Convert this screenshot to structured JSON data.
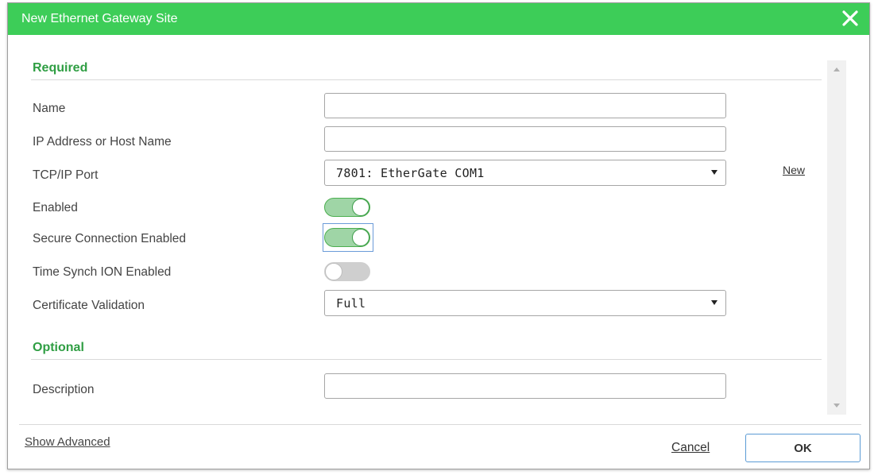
{
  "dialog": {
    "title": "New Ethernet Gateway Site",
    "close_icon": "close-icon"
  },
  "required": {
    "title": "Required",
    "name_label": "Name",
    "name_value": "",
    "ip_label": "IP Address or Host Name",
    "ip_value": "",
    "port_label": "TCP/IP Port",
    "port_value": "7801: EtherGate COM1",
    "new_link": "New",
    "enabled_label": "Enabled",
    "enabled_on": true,
    "secure_label": "Secure Connection Enabled",
    "secure_on": true,
    "timesynch_label": "Time Synch ION Enabled",
    "timesynch_on": false,
    "cert_label": "Certificate Validation",
    "cert_value": "Full"
  },
  "optional": {
    "title": "Optional",
    "description_label": "Description",
    "description_value": ""
  },
  "footer": {
    "show_advanced": "Show Advanced",
    "cancel": "Cancel",
    "ok": "OK"
  },
  "colors": {
    "titlebar": "#3dcd58",
    "section_title": "#2f9e43",
    "toggle_on": "#9fd5a6",
    "toggle_off": "#cfcfcf",
    "focus": "#5b9bd5"
  }
}
